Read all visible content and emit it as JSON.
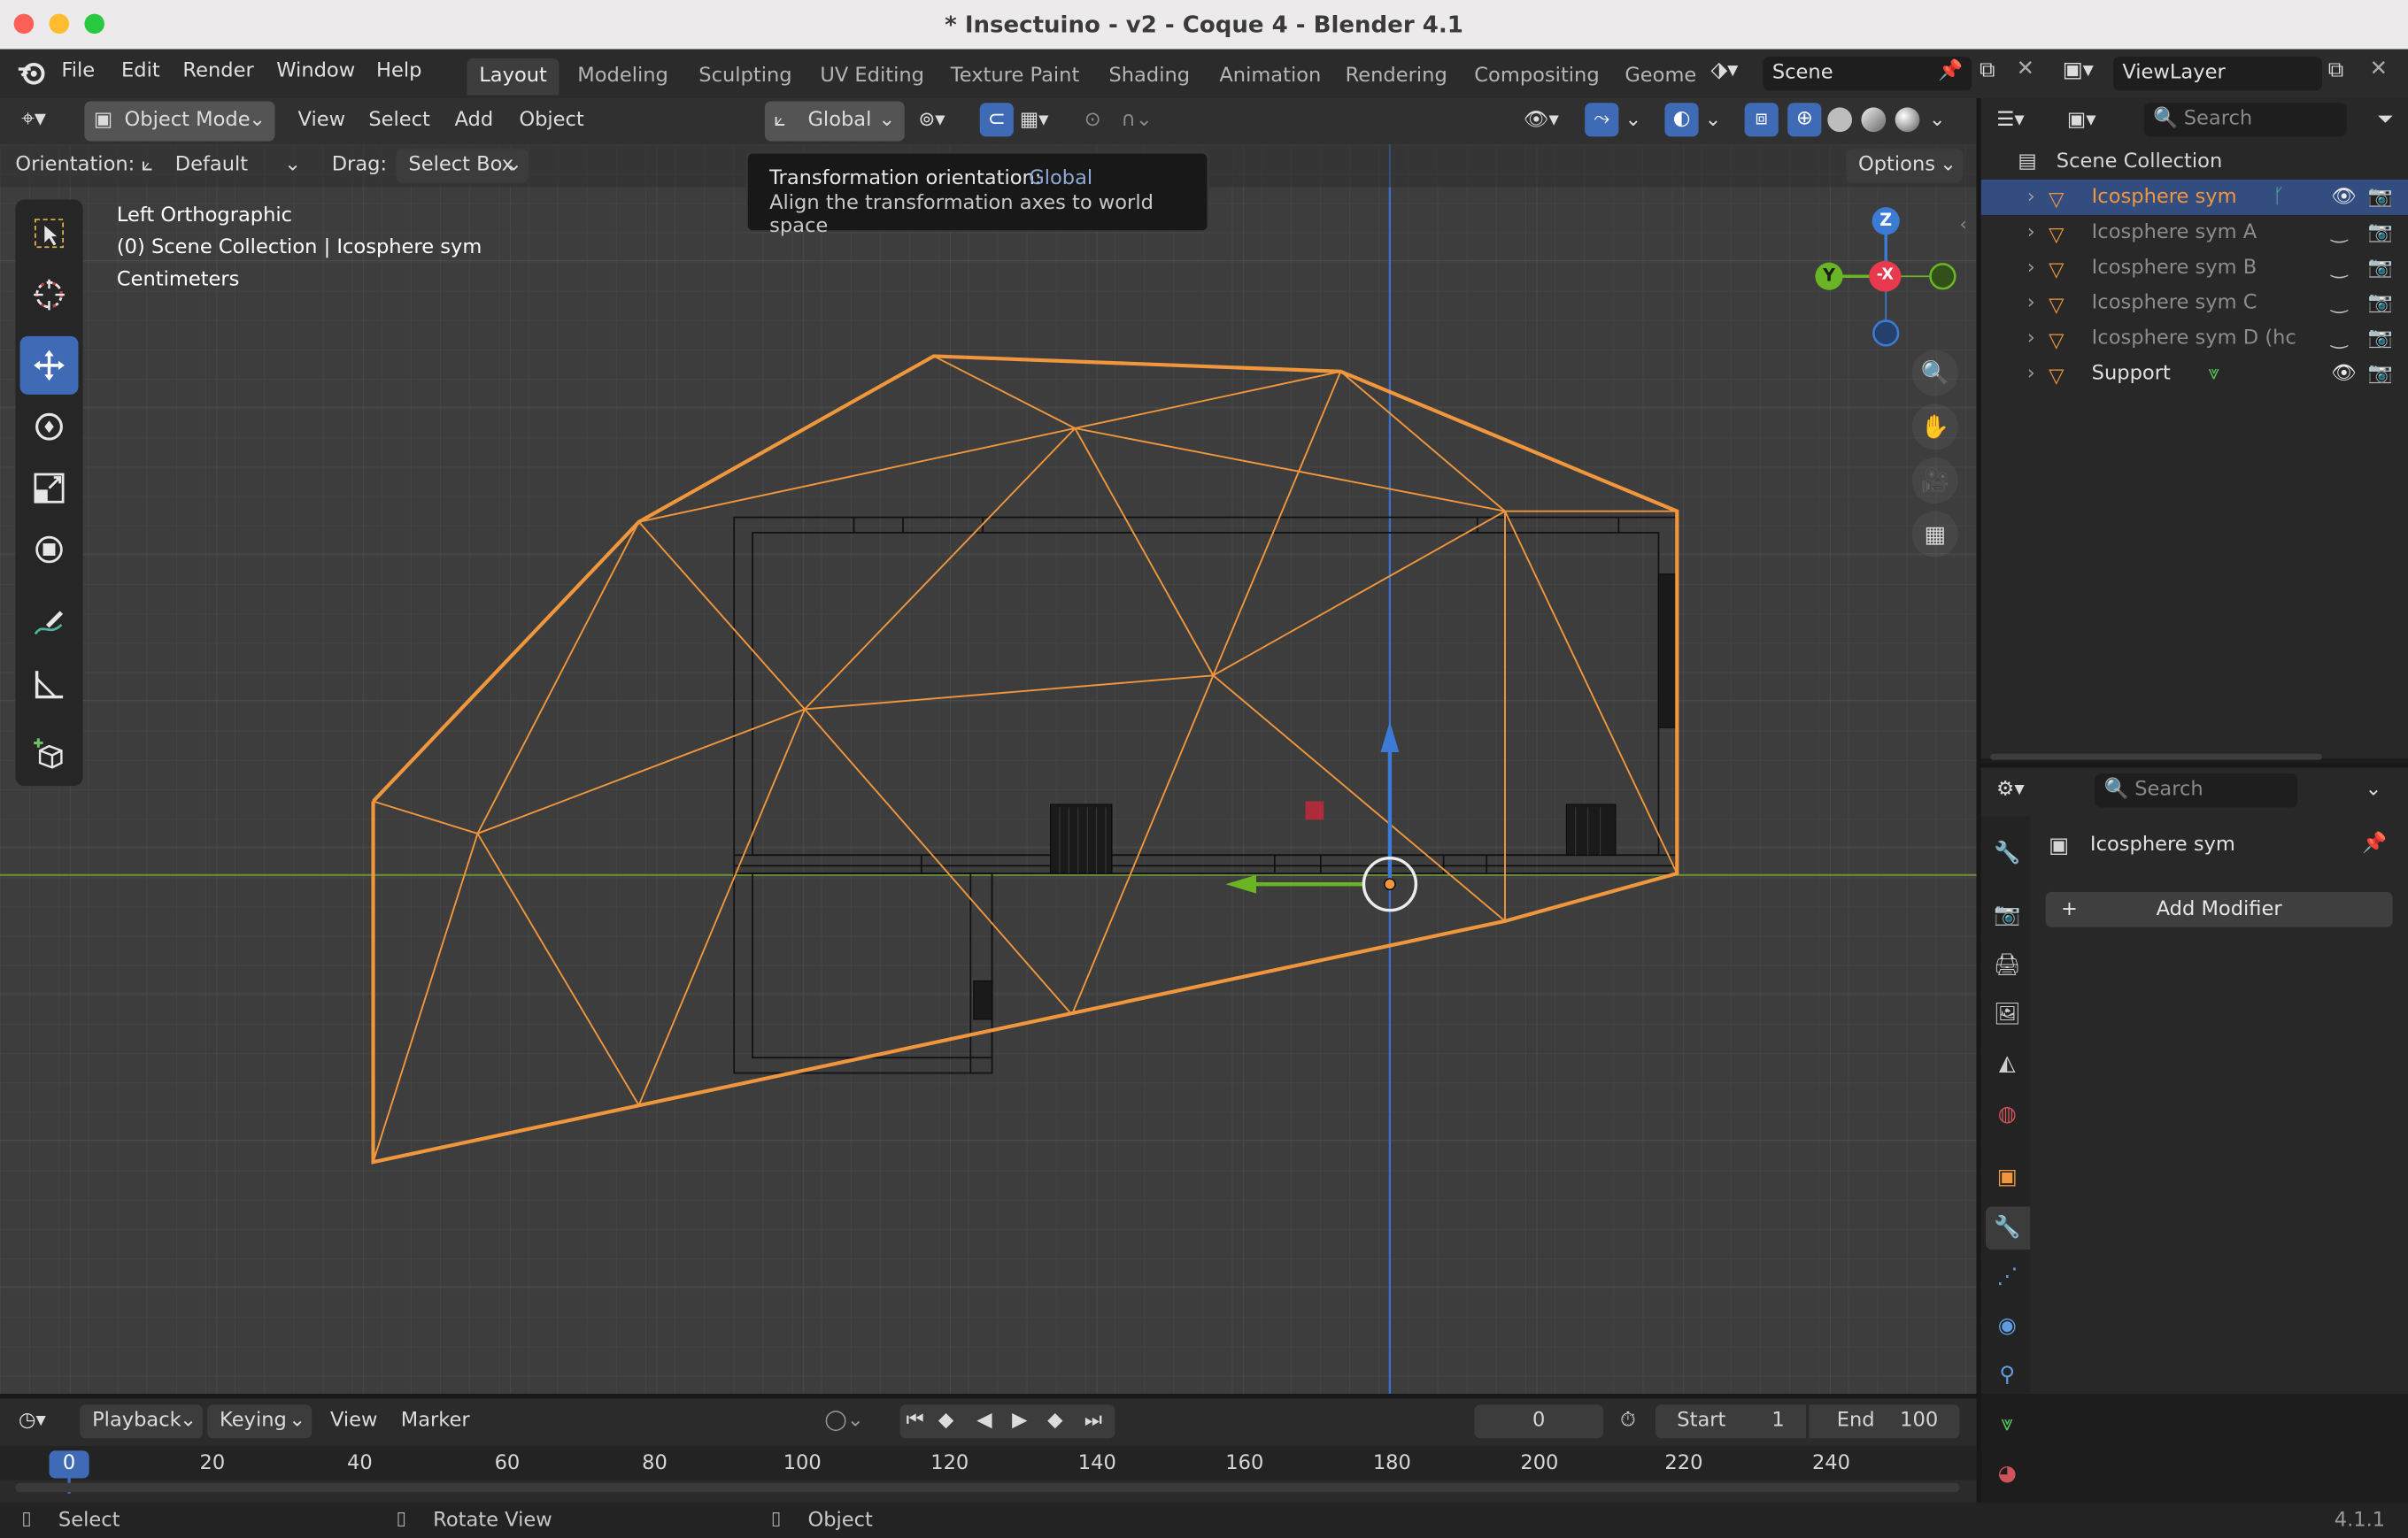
{
  "window": {
    "title": "* Insectuino - v2 - Coque 4 - Blender 4.1"
  },
  "menu": [
    "File",
    "Edit",
    "Render",
    "Window",
    "Help"
  ],
  "workspaces": [
    {
      "label": "Layout",
      "active": true
    },
    {
      "label": "Modeling"
    },
    {
      "label": "Sculpting"
    },
    {
      "label": "UV Editing"
    },
    {
      "label": "Texture Paint"
    },
    {
      "label": "Shading"
    },
    {
      "label": "Animation"
    },
    {
      "label": "Rendering"
    },
    {
      "label": "Compositing"
    },
    {
      "label": "Geome"
    }
  ],
  "scene": {
    "name": "Scene",
    "view_layer": "ViewLayer"
  },
  "viewport_header": {
    "mode": "Object Mode",
    "menus": [
      "View",
      "Select",
      "Add",
      "Object"
    ],
    "transform_orientation": "Global"
  },
  "tool_settings": {
    "orientation_label": "Orientation:",
    "orientation_value": "Default",
    "drag_label": "Drag:",
    "drag_value": "Select Box",
    "options_label": "Options"
  },
  "tooltip": {
    "title": "Transformation orientation:",
    "value": "Global",
    "description": "Align the transformation axes to world space"
  },
  "viewport_info": {
    "view": "Left Orthographic",
    "collection": "(0) Scene Collection | Icosphere sym",
    "units": "Centimeters"
  },
  "gizmo": {
    "z": "Z",
    "y": "Y",
    "x": "-X"
  },
  "outliner": {
    "search_placeholder": "Search",
    "root": "Scene Collection",
    "items": [
      {
        "name": "Icosphere sym",
        "selected": true,
        "visible": true
      },
      {
        "name": "Icosphere sym A",
        "visible": false
      },
      {
        "name": "Icosphere sym B",
        "visible": false
      },
      {
        "name": "Icosphere sym C",
        "visible": false
      },
      {
        "name": "Icosphere sym D (hc",
        "visible": false
      },
      {
        "name": "Support",
        "visible": true
      }
    ]
  },
  "properties": {
    "search_placeholder": "Search",
    "object_name": "Icosphere sym",
    "add_modifier": "Add Modifier"
  },
  "timeline": {
    "menus": [
      "Playback",
      "Keying",
      "View",
      "Marker"
    ],
    "current_frame": "0",
    "start_label": "Start",
    "start_value": "1",
    "end_label": "End",
    "end_value": "100",
    "ruler": [
      "0",
      "20",
      "40",
      "60",
      "80",
      "100",
      "120",
      "140",
      "160",
      "180",
      "200",
      "220",
      "240"
    ]
  },
  "statusbar": {
    "select": "Select",
    "rotate": "Rotate View",
    "object": "Object",
    "version": "4.1.1"
  },
  "colors": {
    "accent": "#3f6ab5",
    "selection": "#f0963c",
    "x_axis": "#e8394f",
    "y_axis": "#6ab524",
    "z_axis": "#3b7bd6"
  }
}
